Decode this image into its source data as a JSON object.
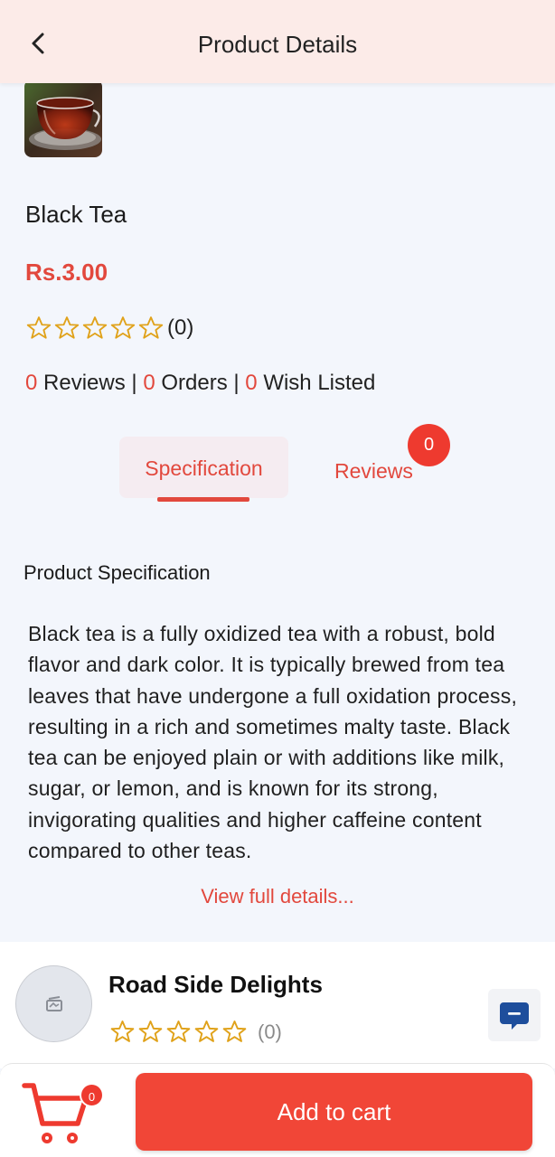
{
  "header": {
    "title": "Product Details",
    "back_icon": "chevron-left-icon"
  },
  "product": {
    "name": "Black Tea",
    "price": "Rs.3.00",
    "rating": 0,
    "rating_count": "(0)",
    "reviews_count": "0",
    "reviews_label": "Reviews",
    "orders_count": "0",
    "orders_label": "Orders",
    "wish_count": "0",
    "wish_label": "Wish Listed",
    "separator": "|"
  },
  "tabs": {
    "spec_label": "Specification",
    "reviews_label": "Reviews",
    "reviews_badge": "0",
    "active": "Specification"
  },
  "spec": {
    "title": "Product Specification",
    "body": "Black tea is a fully oxidized tea with a robust, bold flavor and dark color. It is typically brewed from tea leaves that have undergone a full oxidation process, resulting in a rich and sometimes malty taste. Black tea can be enjoyed plain or with additions like milk, sugar, or lemon, and is known for its strong, invigorating qualities and higher caffeine content compared to other teas.",
    "view_full": "View full details..."
  },
  "store": {
    "name": "Road Side Delights",
    "rating": 0,
    "rating_count": "(0)",
    "avatar_icon": "store-placeholder-icon",
    "chat_icon": "chat-icon"
  },
  "bottom": {
    "cart_icon": "cart-icon",
    "cart_badge": "0",
    "add_to_cart": "Add to cart"
  },
  "colors": {
    "accent": "#e2483d",
    "header_bg": "#fcebe8",
    "page_bg": "#f3f6fc",
    "star": "#e0a21a",
    "button": "#f14637",
    "chat": "#1e4e9c"
  }
}
